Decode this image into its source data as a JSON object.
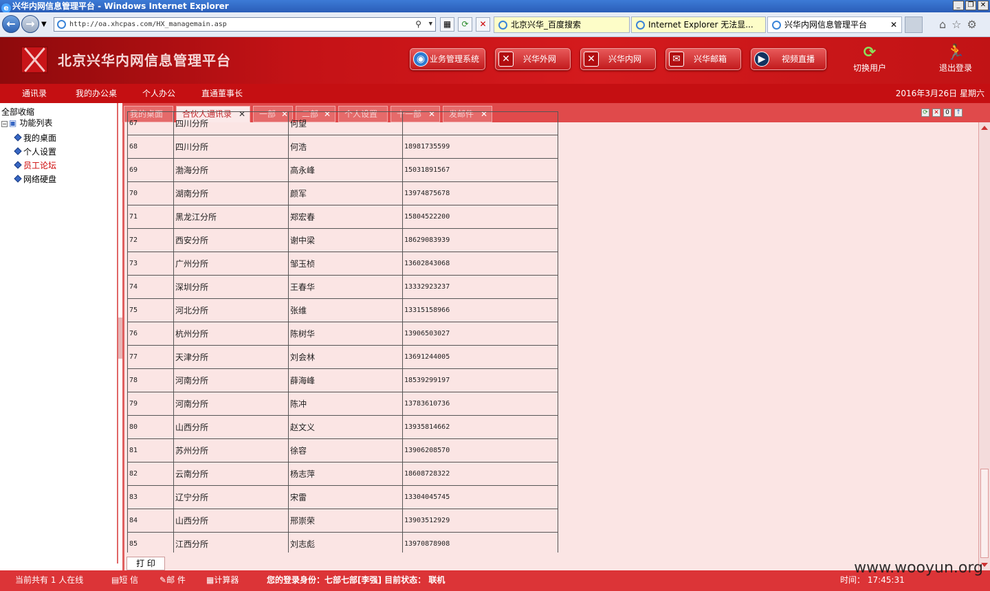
{
  "browser": {
    "window_title": "兴华内网信息管理平台 - Windows Internet Explorer",
    "address": "http://oa.xhcpas.com/HX_managemain.asp",
    "tabs": [
      "北京兴华_百度搜索",
      "Internet Explorer 无法显...",
      "兴华内网信息管理平台"
    ]
  },
  "header": {
    "title": "北京兴华内网信息管理平台",
    "buttons": [
      "业务管理系统",
      "兴华外网",
      "兴华内网",
      "兴华邮箱",
      "视频直播"
    ],
    "switch_user": "切换用户",
    "logout": "退出登录"
  },
  "menu": {
    "items": [
      "通讯录",
      "我的办公桌",
      "个人办公",
      "直通董事长"
    ],
    "date": "2016年3月26日 星期六"
  },
  "sidebar": {
    "collapse_all": "全部收缩",
    "root": "功能列表",
    "items": [
      "我的桌面",
      "个人设置",
      "员工论坛",
      "网络硬盘"
    ],
    "highlight_color": "#cc0000"
  },
  "content_tabs": [
    "我的桌面",
    "合伙人通讯录",
    "一部",
    "二部",
    "个人设置",
    "十一部",
    "发邮件"
  ],
  "table": {
    "partial_row": {
      "num": "67",
      "branch": "四川分所",
      "name": "何望",
      "phone": ""
    },
    "rows": [
      {
        "num": "68",
        "branch": "四川分所",
        "name": "何浩",
        "phone": "18981735599"
      },
      {
        "num": "69",
        "branch": "渤海分所",
        "name": "高永峰",
        "phone": "15031891567"
      },
      {
        "num": "70",
        "branch": "湖南分所",
        "name": "颜军",
        "phone": "13974875678"
      },
      {
        "num": "71",
        "branch": "黑龙江分所",
        "name": "郑宏春",
        "phone": "15804522200"
      },
      {
        "num": "72",
        "branch": "西安分所",
        "name": "谢中梁",
        "phone": "18629083939"
      },
      {
        "num": "73",
        "branch": "广州分所",
        "name": "邹玉桢",
        "phone": "13602843068"
      },
      {
        "num": "74",
        "branch": "深圳分所",
        "name": "王春华",
        "phone": "13332923237"
      },
      {
        "num": "75",
        "branch": "河北分所",
        "name": "张维",
        "phone": "13315158966"
      },
      {
        "num": "76",
        "branch": "杭州分所",
        "name": "陈树华",
        "phone": "13906503027"
      },
      {
        "num": "77",
        "branch": "天津分所",
        "name": "刘会林",
        "phone": "13691244005"
      },
      {
        "num": "78",
        "branch": "河南分所",
        "name": "薛海峰",
        "phone": "18539299197"
      },
      {
        "num": "79",
        "branch": "河南分所",
        "name": "陈冲",
        "phone": "13783610736"
      },
      {
        "num": "80",
        "branch": "山西分所",
        "name": "赵文义",
        "phone": "13935814662"
      },
      {
        "num": "81",
        "branch": "苏州分所",
        "name": "徐容",
        "phone": "13906208570"
      },
      {
        "num": "82",
        "branch": "云南分所",
        "name": "杨志萍",
        "phone": "18608728322"
      },
      {
        "num": "83",
        "branch": "辽宁分所",
        "name": "宋雷",
        "phone": "13304045745"
      },
      {
        "num": "84",
        "branch": "山西分所",
        "name": "邢崇荣",
        "phone": "13903512929"
      },
      {
        "num": "85",
        "branch": "江西分所",
        "name": "刘志彪",
        "phone": "13970878908"
      }
    ]
  },
  "print_button": "打 印",
  "status": {
    "online": "当前共有 1 人在线",
    "sms": "短 信",
    "mail": "邮 件",
    "calc": "计算器",
    "identity": "您的登录身份：七部七部[李强]  目前状态： 联机",
    "time": "时间： 17:45:31"
  },
  "watermark": "www.wooyun.org",
  "colors": {
    "header_red": "#c41216",
    "menu_red": "#c50f12",
    "content_bg": "#fbe5e4"
  }
}
